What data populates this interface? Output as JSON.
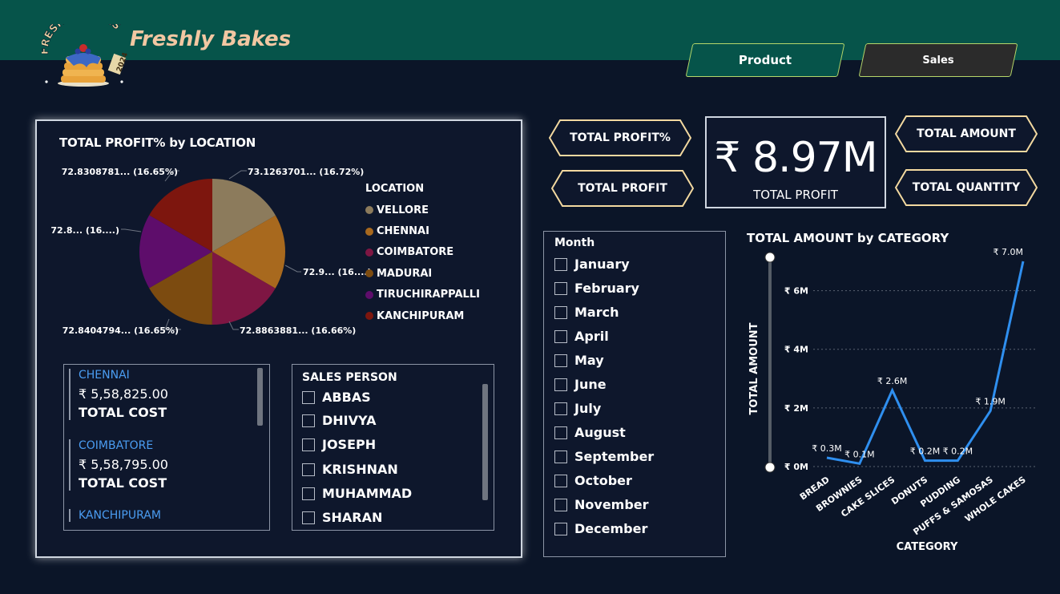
{
  "header": {
    "brand": "Freshly Bakes",
    "logo_text": "FRESHLY BAKES",
    "logo_year": "2024",
    "nav": [
      {
        "label": "Product"
      },
      {
        "label": "Sales"
      }
    ]
  },
  "pie": {
    "title": "TOTAL PROFIT% by LOCATION",
    "legend_title": "LOCATION",
    "legend": [
      {
        "name": "VELLORE",
        "color": "#8c7b5c"
      },
      {
        "name": "CHENNAI",
        "color": "#a8691e"
      },
      {
        "name": "COIMBATORE",
        "color": "#7e1643"
      },
      {
        "name": "MADURAI",
        "color": "#7c4b10"
      },
      {
        "name": "TIRUCHIRAPPALLI",
        "color": "#5e0d6b"
      },
      {
        "name": "KANCHIPURAM",
        "color": "#7d160e"
      }
    ],
    "labels": {
      "vellore": "73.1263701... (16.72%)",
      "chennai": "72.9... (16....)",
      "coimbatore": "72.8863881... (16.66%)",
      "madurai": "72.8404794... (16.65%)",
      "tiruchirappalli": "72.8... (16....)",
      "kanchipuram": "72.8308781... (16.65%)"
    }
  },
  "chart_data": [
    {
      "type": "pie",
      "title": "TOTAL PROFIT% by LOCATION",
      "categories": [
        "VELLORE",
        "CHENNAI",
        "COIMBATORE",
        "MADURAI",
        "TIRUCHIRAPPALLI",
        "KANCHIPURAM"
      ],
      "values": [
        16.72,
        16.66,
        16.66,
        16.65,
        16.66,
        16.65
      ],
      "legend": "right"
    },
    {
      "type": "line",
      "title": "TOTAL AMOUNT by CATEGORY",
      "xlabel": "CATEGORY",
      "ylabel": "TOTAL AMOUNT",
      "categories": [
        "BREAD",
        "BROWNIES",
        "CAKE SLICES",
        "DONUTS",
        "PUDDING",
        "PUFFS & SAMOSAS",
        "WHOLE CAKES"
      ],
      "values": [
        0.3,
        0.1,
        2.6,
        0.2,
        0.2,
        1.9,
        7.0
      ],
      "data_labels": [
        "₹ 0.3M",
        "₹ 0.1M",
        "₹ 2.6M",
        "₹ 0.2M",
        "₹ 0.2M",
        "₹ 1.9M",
        "₹ 7.0M"
      ],
      "yticks": [
        "₹ 0M",
        "₹ 2M",
        "₹ 4M",
        "₹ 6M"
      ],
      "ylim": [
        0,
        7
      ],
      "grid": true,
      "color": "#2f8fef"
    }
  ],
  "location_cost": {
    "items": [
      {
        "name": "CHENNAI",
        "value": "₹ 5,58,825.00",
        "label": "TOTAL COST"
      },
      {
        "name": "COIMBATORE",
        "value": "₹ 5,58,795.00",
        "label": "TOTAL COST"
      },
      {
        "name": "KANCHIPURAM"
      }
    ]
  },
  "sales_person": {
    "title": "SALES PERSON",
    "names": [
      "ABBAS",
      "DHIVYA",
      "JOSEPH",
      "KRISHNAN",
      "MUHAMMAD",
      "SHARAN"
    ]
  },
  "measures": {
    "total_profit_pct": "TOTAL PROFIT%",
    "total_profit": "TOTAL PROFIT",
    "total_amount": "TOTAL AMOUNT",
    "total_quantity": "TOTAL QUANTITY"
  },
  "kpi": {
    "value": "₹ 8.97M",
    "label": "TOTAL PROFIT"
  },
  "month_filter": {
    "title": "Month",
    "months": [
      "January",
      "February",
      "March",
      "April",
      "May",
      "June",
      "July",
      "August",
      "September",
      "October",
      "November",
      "December"
    ]
  }
}
